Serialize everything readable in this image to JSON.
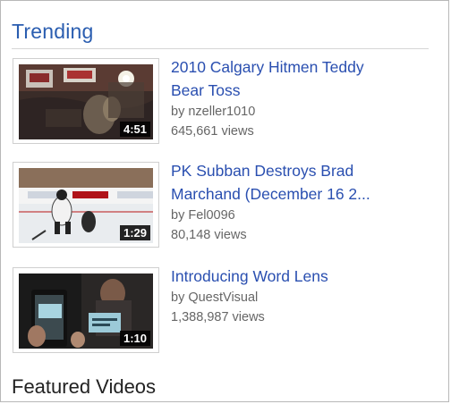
{
  "section": {
    "trending_label": "Trending",
    "featured_label": "Featured Videos"
  },
  "videos": [
    {
      "title_line1": "2010 Calgary Hitmen Teddy",
      "title_line2": "Bear Toss",
      "by": "by nzeller1010",
      "views": "645,661 views",
      "duration": "4:51"
    },
    {
      "title_line1": "PK Subban Destroys Brad",
      "title_line2": "Marchand (December 16 2...",
      "by": "by Fel0096",
      "views": "80,148 views",
      "duration": "1:29"
    },
    {
      "title_line1": "Introducing Word Lens",
      "title_line2": "",
      "by": "by QuestVisual",
      "views": "1,388,987 views",
      "duration": "1:10"
    }
  ],
  "colors": {
    "link": "#2a4fb0",
    "heading": "#2a5db0",
    "meta": "#666666"
  }
}
